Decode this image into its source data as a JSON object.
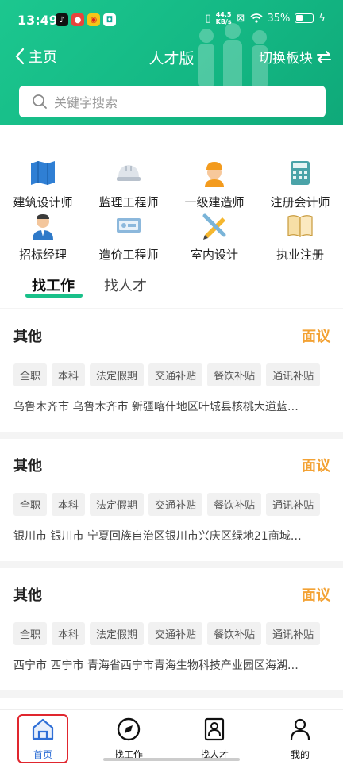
{
  "status": {
    "time": "13:49",
    "speed_top": "44.5",
    "speed_unit": "KB/s",
    "battery": "35%"
  },
  "nav": {
    "back_label": "主页",
    "title": "人才版",
    "switch_label": "切换板块"
  },
  "search": {
    "placeholder": "关键字搜索"
  },
  "categories": [
    {
      "label": "建筑设计师",
      "icon": "blueprint-icon"
    },
    {
      "label": "监理工程师",
      "icon": "helmet-icon"
    },
    {
      "label": "一级建造师",
      "icon": "worker-icon"
    },
    {
      "label": "注册会计师",
      "icon": "calculator-icon"
    },
    {
      "label": "招标经理",
      "icon": "manager-icon"
    },
    {
      "label": "造价工程师",
      "icon": "banknote-icon"
    },
    {
      "label": "室内设计",
      "icon": "pencil-ruler-icon"
    },
    {
      "label": "执业注册",
      "icon": "book-icon"
    }
  ],
  "tabs": [
    {
      "label": "找工作",
      "active": true
    },
    {
      "label": "找人才",
      "active": false
    }
  ],
  "jobs": [
    {
      "title": "其他",
      "salary": "面议",
      "tags": [
        "全职",
        "本科",
        "法定假期",
        "交通补贴",
        "餐饮补贴",
        "通讯补贴"
      ],
      "address": "乌鲁木齐市 乌鲁木齐市 新疆喀什地区叶城县核桃大道蓝…"
    },
    {
      "title": "其他",
      "salary": "面议",
      "tags": [
        "全职",
        "本科",
        "法定假期",
        "交通补贴",
        "餐饮补贴",
        "通讯补贴"
      ],
      "address": "银川市 银川市 宁夏回族自治区银川市兴庆区绿地21商城…"
    },
    {
      "title": "其他",
      "salary": "面议",
      "tags": [
        "全职",
        "本科",
        "法定假期",
        "交通补贴",
        "餐饮补贴",
        "通讯补贴"
      ],
      "address": "西宁市 西宁市 青海省西宁市青海生物科技产业园区海湖…"
    }
  ],
  "bottom_nav": [
    {
      "label": "首页",
      "icon": "home-icon",
      "active": true
    },
    {
      "label": "找工作",
      "icon": "compass-icon",
      "active": false
    },
    {
      "label": "找人才",
      "icon": "resume-icon",
      "active": false
    },
    {
      "label": "我的",
      "icon": "person-icon",
      "active": false
    }
  ],
  "colors": {
    "header_green": "#14b884",
    "accent_green": "#19c089",
    "salary_orange": "#f3a234",
    "active_blue": "#2f6fd6",
    "highlight_red": "#e0262e"
  }
}
